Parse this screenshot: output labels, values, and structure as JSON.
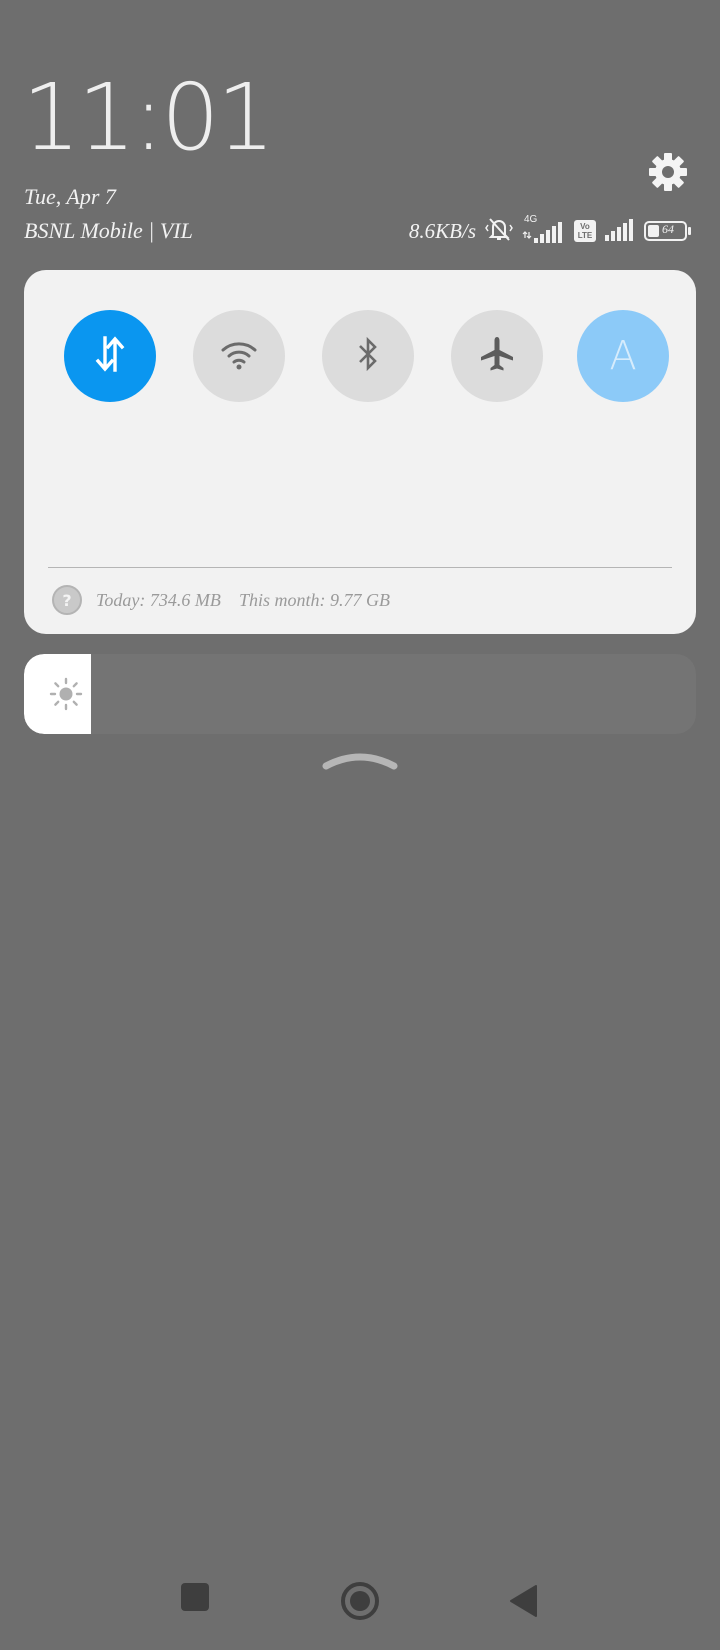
{
  "header": {
    "time": "11:01",
    "date": "Tue, Apr 7",
    "carrier": "BSNL Mobile | VIL",
    "network_speed": "8.6KB/s",
    "network_type": "4G",
    "volte_line1": "Vo",
    "volte_line2": "LTE",
    "battery_level": "64",
    "settings_icon": "gear-icon"
  },
  "quick_toggles": [
    {
      "name": "mobile-data",
      "icon": "data-arrows-icon",
      "state": "on"
    },
    {
      "name": "wifi",
      "icon": "wifi-icon",
      "state": "off"
    },
    {
      "name": "bluetooth",
      "icon": "bluetooth-icon",
      "state": "off"
    },
    {
      "name": "airplane-mode",
      "icon": "airplane-icon",
      "state": "off"
    },
    {
      "name": "auto-brightness",
      "label": "A",
      "state": "on"
    }
  ],
  "data_usage": {
    "today": "Today: 734.6 MB",
    "this_month": "This month: 9.77 GB",
    "help_glyph": "?"
  },
  "brightness": {
    "level_fraction": 0.1,
    "icon": "sun-icon"
  },
  "colors": {
    "accent": "#0a96f0",
    "auto_toggle": "#8ccaf8",
    "panel_bg": "#f2f2f2",
    "scrim": "#6e6e6e"
  },
  "navbar": {
    "recents_icon": "square-icon",
    "home_icon": "circle-icon",
    "back_icon": "triangle-back-icon"
  }
}
